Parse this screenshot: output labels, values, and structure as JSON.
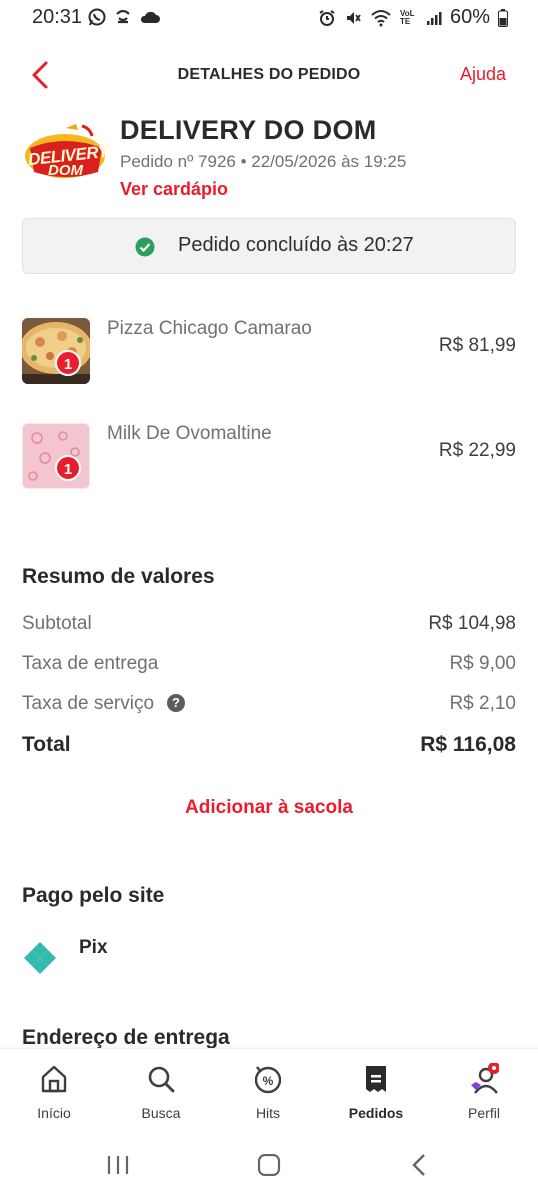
{
  "status_bar": {
    "time": "20:31",
    "battery": "60%",
    "left_icons": [
      "whatsapp-icon",
      "app-notification-icon",
      "cloud-icon"
    ],
    "right_icons": [
      "alarm-icon",
      "mute-icon",
      "wifi-icon",
      "volte-icon",
      "signal-icon",
      "battery-icon"
    ],
    "volte_label": "VoLTE"
  },
  "header": {
    "title": "DETALHES DO PEDIDO",
    "help": "Ajuda"
  },
  "store": {
    "name": "DELIVERY DO DOM",
    "order_meta": "Pedido nº 7926 • 22/05/2026 às 19:25",
    "menu_link": "Ver cardápio",
    "logo_text_1": "DELIVERY",
    "logo_text_2": "DOM"
  },
  "order_status": {
    "text": "Pedido concluído às 20:27"
  },
  "items": [
    {
      "name": "Pizza Chicago Camarao",
      "price": "R$ 81,99",
      "qty": "1"
    },
    {
      "name": "Milk De Ovomaltine",
      "price": "R$ 22,99",
      "qty": "1"
    }
  ],
  "summary": {
    "title": "Resumo de valores",
    "subtotal_label": "Subtotal",
    "subtotal_value": "R$ 104,98",
    "delivery_label": "Taxa de entrega",
    "delivery_value": "R$ 9,00",
    "service_label": "Taxa de serviço",
    "service_value": "R$ 2,10",
    "total_label": "Total",
    "total_value": "R$ 116,08"
  },
  "add_to_bag": "Adicionar à sacola",
  "payment": {
    "title": "Pago pelo site",
    "method": "Pix"
  },
  "address": {
    "title": "Endereço de entrega"
  },
  "nav": {
    "items": [
      {
        "label": "Início",
        "icon": "home-icon"
      },
      {
        "label": "Busca",
        "icon": "search-icon"
      },
      {
        "label": "Hits",
        "icon": "hits-icon"
      },
      {
        "label": "Pedidos",
        "icon": "orders-icon"
      },
      {
        "label": "Perfil",
        "icon": "profile-icon"
      }
    ],
    "active": "Pedidos"
  },
  "colors": {
    "brand_red": "#ea1d2c",
    "success_green": "#2e9e5b",
    "pix_teal": "#32bcad"
  }
}
